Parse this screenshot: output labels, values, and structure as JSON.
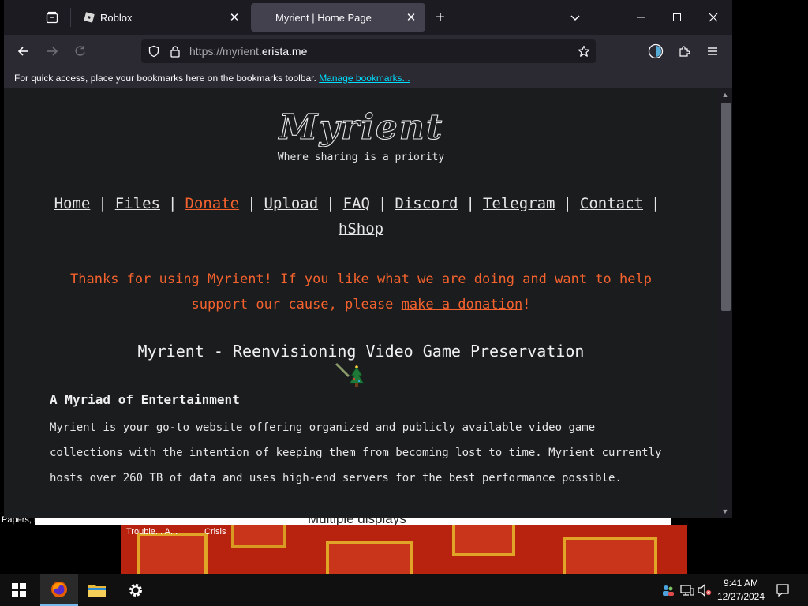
{
  "desktop": {
    "window_title": "Multiple displays",
    "label_papers": "Papers, H",
    "game_labels": [
      "Trouble... A...",
      "Crisis"
    ]
  },
  "browser": {
    "tabs": [
      {
        "title": "Roblox",
        "active": false
      },
      {
        "title": "Myrient | Home Page",
        "active": true
      }
    ],
    "url_prefix": "https://myrient.",
    "url_domain": "erista.me",
    "bookmarks_hint": "For quick access, place your bookmarks here on the bookmarks toolbar.",
    "bookmarks_link": "Manage bookmarks..."
  },
  "page": {
    "logo_text": "Myrient",
    "tagline": "Where sharing is a priority",
    "nav": {
      "home": "Home",
      "files": "Files",
      "donate": "Donate",
      "upload": "Upload",
      "faq": "FAQ",
      "discord": "Discord",
      "telegram": "Telegram",
      "contact": "Contact",
      "hshop": "hShop",
      "separator": "|"
    },
    "thanks_pre": "Thanks for using Myrient! If you like what we are doing and want to help support our cause, please ",
    "thanks_link": "make a donation",
    "thanks_post": "!",
    "headline": "Myrient - Reenvisioning Video Game Preservation",
    "section_title": "A Myriad of Entertainment",
    "paragraph": "Myrient is your go-to website offering organized and publicly available video game collections with the intention of keeping them from becoming lost to time. Myrient currently hosts over 260 TB of data and uses high-end servers for the best performance possible."
  },
  "taskbar": {
    "time": "9:41 AM",
    "date": "12/27/2024"
  },
  "colors": {
    "accent_orange": "#f4622e",
    "link_cyan": "#00ddff",
    "page_bg": "#1a1c1e"
  }
}
